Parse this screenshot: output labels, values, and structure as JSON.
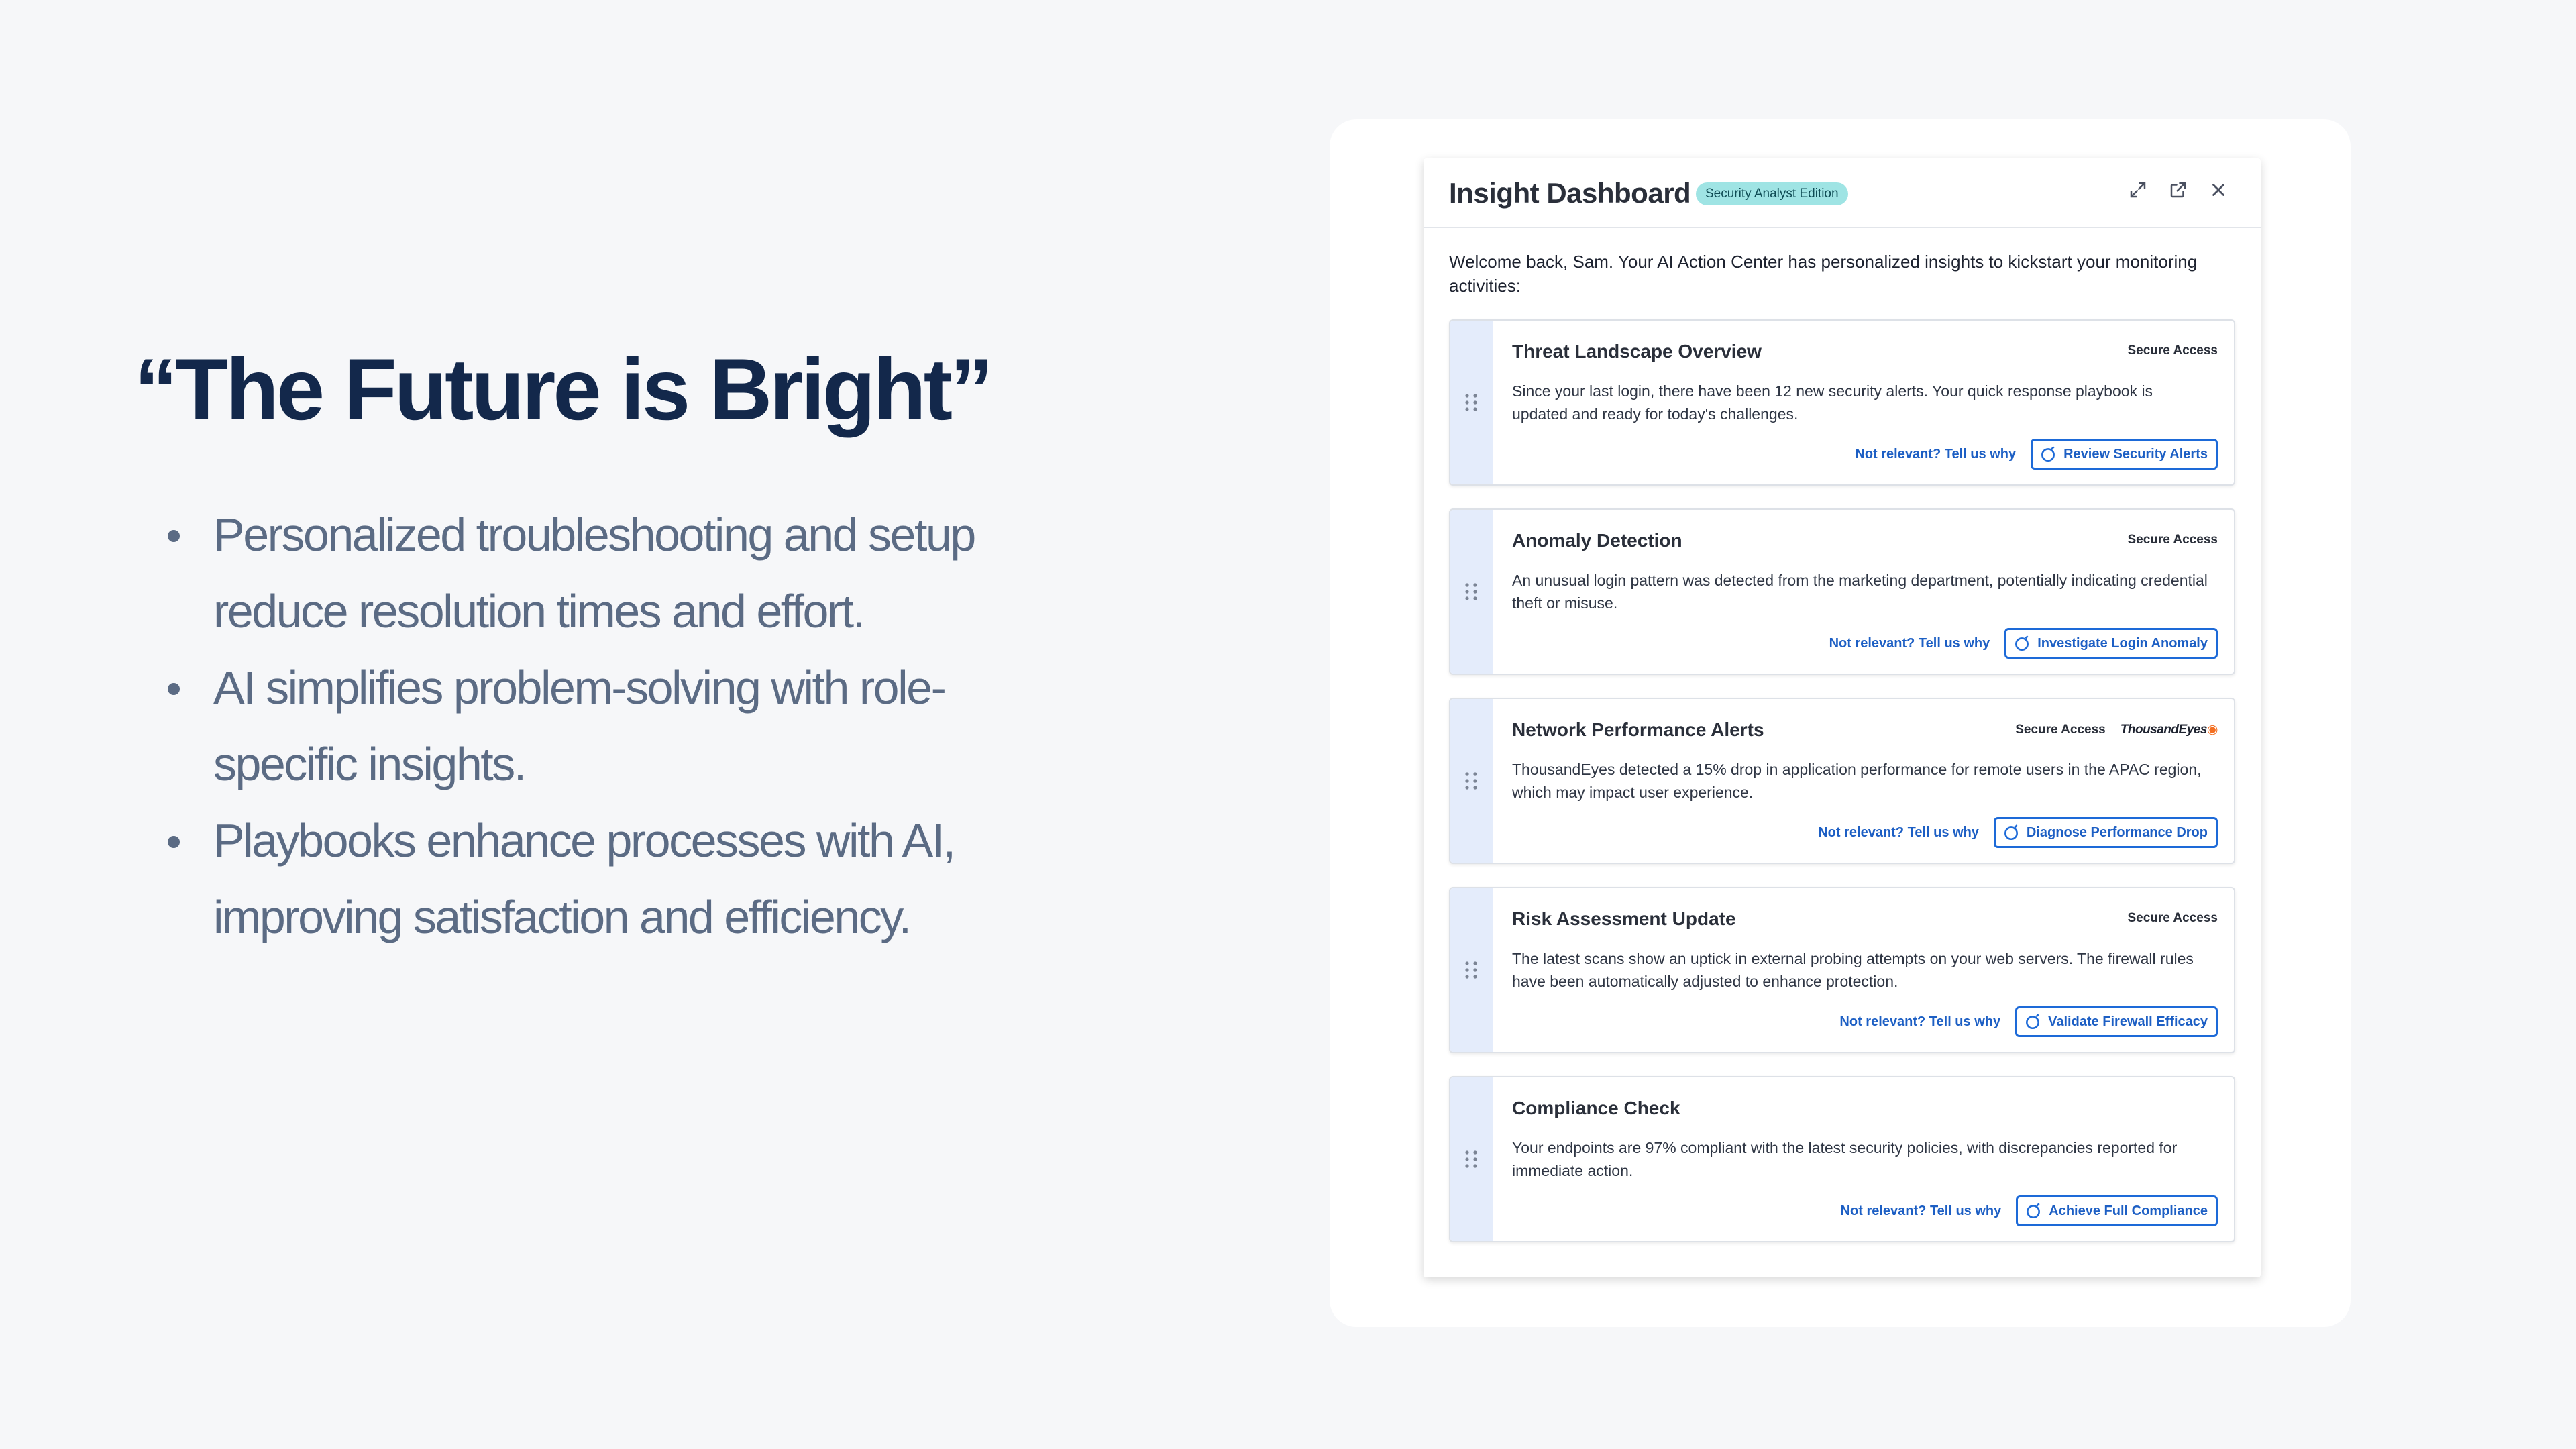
{
  "slide": {
    "headline": "“The Future is Bright”",
    "bullets": [
      "Personalized troubleshooting and setup reduce resolution times and effort.",
      "AI simplifies problem-solving with role-specific insights.",
      "Playbooks enhance processes with AI, improving satisfaction and efficiency."
    ]
  },
  "dashboard": {
    "title": "Insight Dashboard",
    "badge": "Security Analyst Edition",
    "controls": [
      "expand-icon",
      "open-external-icon",
      "close-icon"
    ],
    "welcome": "Welcome back, Sam. Your AI Action Center has personalized insights to kickstart your monitoring activities:",
    "cards": [
      {
        "title": "Threat Landscape Overview",
        "tag": "Secure Access",
        "description": "Since your last login, there have been 12 new security alerts. Your quick response playbook is updated and ready for today's challenges.",
        "feedback": "Not relevant? Tell us why",
        "action": "Review Security Alerts"
      },
      {
        "title": "Anomaly Detection",
        "tag": "Secure Access",
        "description": "An unusual login pattern was detected from the marketing department, potentially indicating credential theft or misuse.",
        "feedback": "Not relevant? Tell us why",
        "action": "Investigate Login Anomaly"
      },
      {
        "title": "Network Performance Alerts",
        "tag": "Secure Access",
        "brand": "ThousandEyes",
        "description": "ThousandEyes detected a 15% drop in application performance for remote users in the APAC region, which may impact user experience.",
        "feedback": "Not relevant? Tell us why",
        "action": "Diagnose Performance Drop"
      },
      {
        "title": "Risk Assessment Update",
        "tag": "Secure Access",
        "description": "The latest scans show an uptick in external probing attempts on your web servers. The firewall rules have been automatically adjusted to enhance protection.",
        "feedback": "Not relevant? Tell us why",
        "action": "Validate Firewall Efficacy"
      },
      {
        "title": "Compliance Check",
        "description": "Your endpoints are 97% compliant with the latest security policies, with discrepancies reported for immediate action.",
        "feedback": "Not relevant? Tell us why",
        "action": "Achieve Full Compliance"
      }
    ]
  },
  "colors": {
    "background": "#f6f7f9",
    "headline": "#13284b",
    "bullet_text": "#5b6b84",
    "badge_bg": "#9fe4e4",
    "handle_bg": "#e4ecfb",
    "link_blue": "#1d5fc4",
    "brand_orange": "#f36f21"
  }
}
